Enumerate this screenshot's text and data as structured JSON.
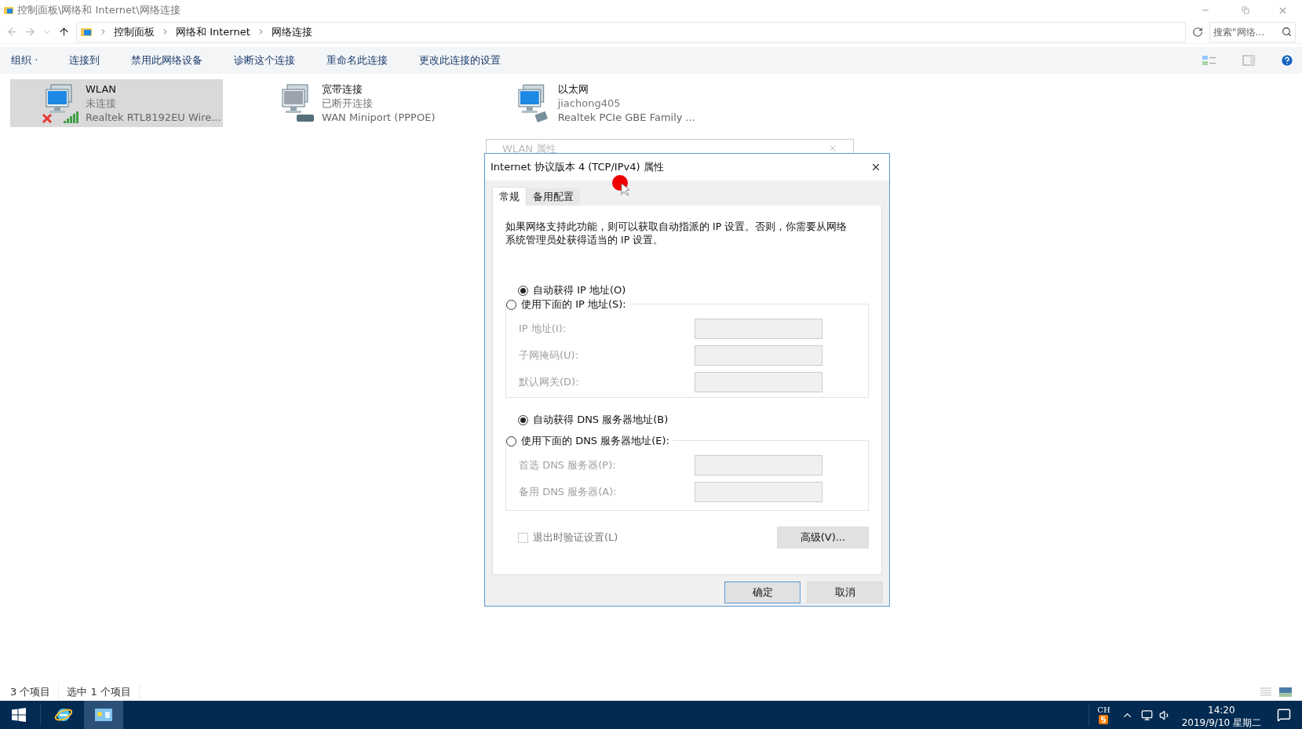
{
  "window": {
    "title": "控制面板\\网络和 Internet\\网络连接"
  },
  "address": {
    "breadcrumbs": [
      "控制面板",
      "网络和 Internet",
      "网络连接"
    ],
    "search_placeholder": "搜索\"网络..."
  },
  "toolbar": {
    "items": [
      "组织 ·",
      "连接到",
      "禁用此网络设备",
      "诊断这个连接",
      "重命名此连接",
      "更改此连接的设置"
    ]
  },
  "connections": [
    {
      "kind": "wireless",
      "name": "WLAN",
      "status": "未连接",
      "adapter": "Realtek RTL8192EU Wire...",
      "selected": true
    },
    {
      "kind": "broadband",
      "name": "宽带连接",
      "status": "已断开连接",
      "adapter": "WAN Miniport (PPPOE)",
      "selected": false
    },
    {
      "kind": "ethernet",
      "name": "以太网",
      "status": "jiachong405",
      "adapter": "Realtek PCIe GBE Family ...",
      "selected": false
    }
  ],
  "status_bar": [
    "3 个项目",
    "选中 1 个项目"
  ],
  "background_dialog": {
    "title": "WLAN 属性"
  },
  "dialog": {
    "title": "Internet 协议版本 4 (TCP/IPv4) 属性",
    "tabs": [
      {
        "label": "常规",
        "selected": true
      },
      {
        "label": "备用配置",
        "selected": false
      }
    ],
    "description": "如果网络支持此功能，则可以获取自动指派的 IP 设置。否则，你需要从网络系统管理员处获得适当的 IP 设置。",
    "ip_options": [
      {
        "label": "自动获得 IP 地址(O)",
        "selected": true
      },
      {
        "label": "使用下面的 IP 地址(S):",
        "selected": false
      }
    ],
    "ip_fields": [
      {
        "label": "IP 地址(I):",
        "disabled": true
      },
      {
        "label": "子网掩码(U):",
        "disabled": true
      },
      {
        "label": "默认网关(D):",
        "disabled": true
      }
    ],
    "dns_options": [
      {
        "label": "自动获得 DNS 服务器地址(B)",
        "selected": true
      },
      {
        "label": "使用下面的 DNS 服务器地址(E):",
        "selected": false
      }
    ],
    "dns_fields": [
      {
        "label": "首选 DNS 服务器(P):",
        "disabled": true
      },
      {
        "label": "备用 DNS 服务器(A):",
        "disabled": true
      }
    ],
    "validate": {
      "label": "退出时验证设置(L)",
      "checked": false,
      "disabled": true
    },
    "advanced_button": "高级(V)...",
    "buttons": [
      "确定",
      "取消"
    ]
  },
  "taskbar": {
    "ime": "CH",
    "time": "14:20",
    "date": "2019/9/10 星期二"
  }
}
